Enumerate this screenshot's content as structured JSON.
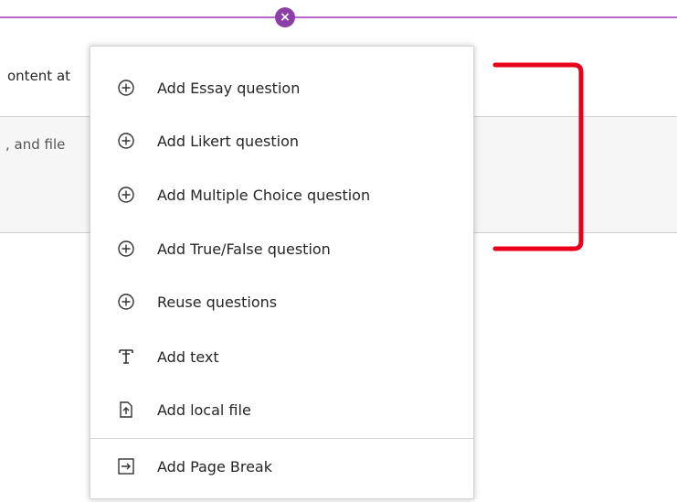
{
  "background": {
    "text_top": "ontent at",
    "text_band": ", and file"
  },
  "close_icon": "×",
  "menu": {
    "items": [
      {
        "label": "Add Essay question",
        "icon": "plus-circle-icon"
      },
      {
        "label": "Add Likert question",
        "icon": "plus-circle-icon"
      },
      {
        "label": "Add Multiple Choice question",
        "icon": "plus-circle-icon"
      },
      {
        "label": "Add True/False question",
        "icon": "plus-circle-icon"
      },
      {
        "label": "Reuse questions",
        "icon": "plus-circle-icon"
      },
      {
        "label": "Add text",
        "icon": "text-icon"
      },
      {
        "label": "Add local file",
        "icon": "file-upload-icon"
      },
      {
        "label": "Add Page Break",
        "icon": "page-break-icon"
      }
    ]
  },
  "colors": {
    "accent_purple": "#8c3fa7",
    "divider_purple": "#b565cc",
    "annotation_red": "#e8001a"
  }
}
